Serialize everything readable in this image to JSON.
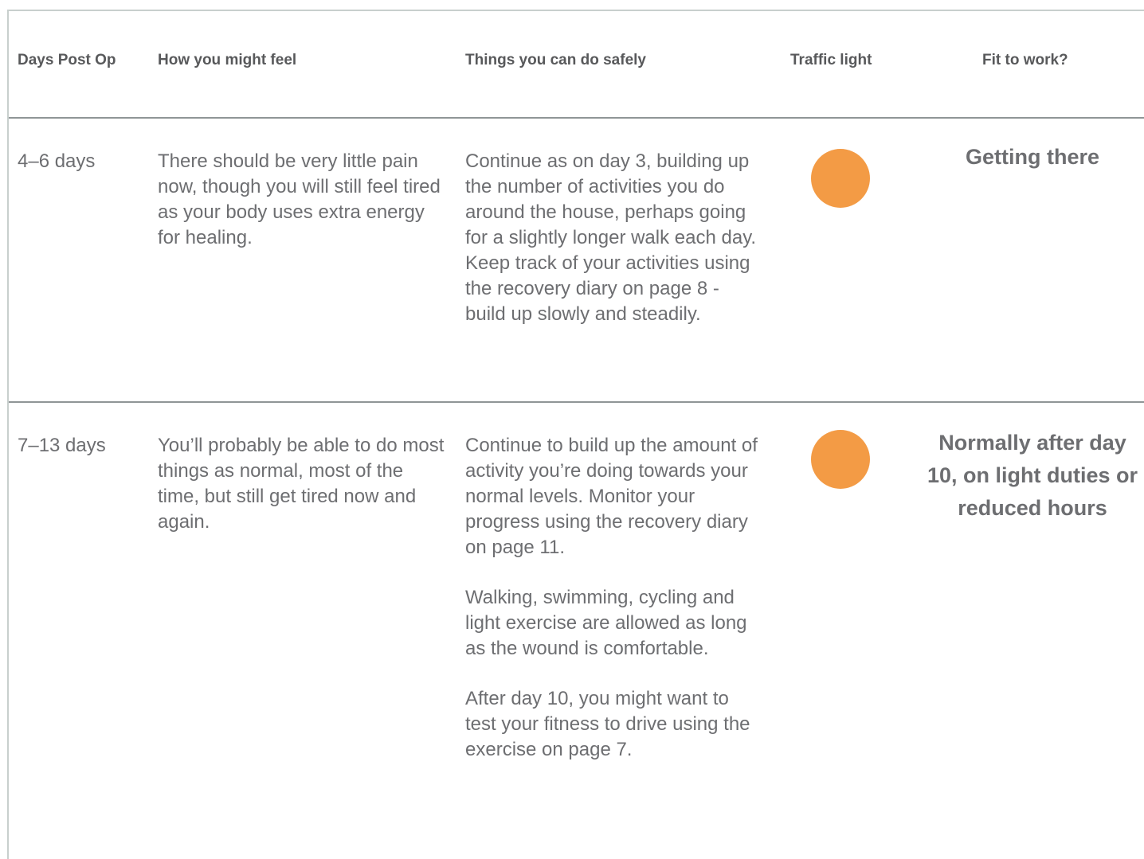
{
  "headers": {
    "days": "Days Post Op",
    "feel": "How you might feel",
    "things": "Things you can do safely",
    "traffic": "Traffic light",
    "fit": "Fit to work?"
  },
  "rows": [
    {
      "days": "4–6 days",
      "feel": "There should be very little pain now, though you will still feel tired as your body uses extra energy for healing.",
      "things": [
        "Continue as on day 3, building up the number of activities you do around the house, perhaps going for a slightly longer walk each day. Keep track of your activities using the recovery diary on page 8 - build up slowly and steadily."
      ],
      "traffic_light": "amber",
      "fit": "Getting there"
    },
    {
      "days": "7–13 days",
      "feel": "You’ll probably be able to do most things as normal, most of the time, but still get tired now and again.",
      "things": [
        "Continue to build up the amount of activity you’re doing towards your normal levels. Monitor your progress using the recovery diary on page 11.",
        "Walking, swimming, cycling and light exercise are allowed as long as the wound is comfortable.",
        "After day 10, you might want to test your fitness to drive using the exercise on page 7."
      ],
      "traffic_light": "amber",
      "fit": "Normally after day 10, on light duties or reduced hours"
    }
  ],
  "colors": {
    "amber": "#f39b45",
    "text": "#6d6e71",
    "header": "#58595b",
    "rule": "#8f9596"
  }
}
